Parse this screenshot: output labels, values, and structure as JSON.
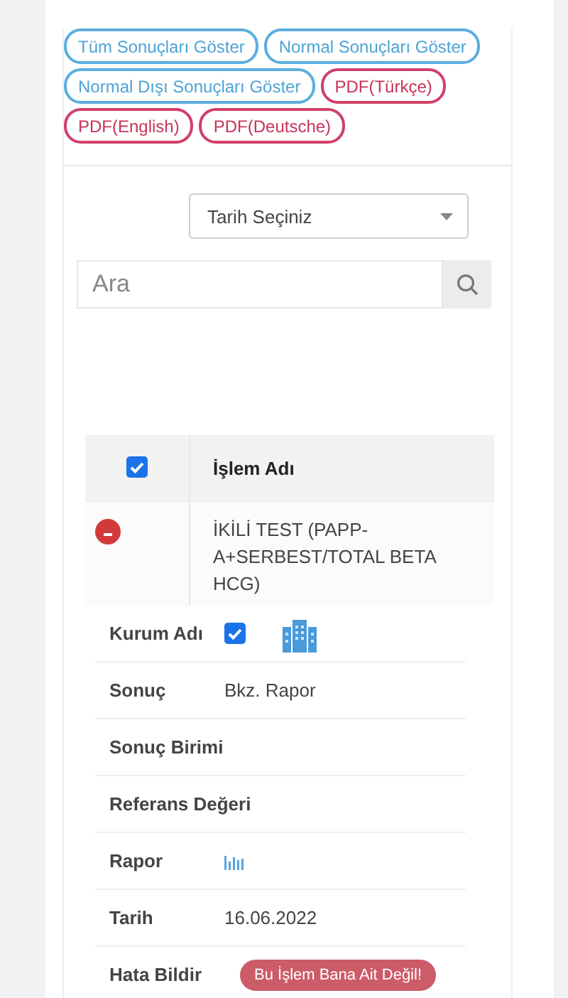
{
  "filters": [
    {
      "label": "Tüm Sonuçları Göster",
      "kind": "filter"
    },
    {
      "label": "Normal Sonuçları Göster",
      "kind": "filter"
    },
    {
      "label": "Normal Dışı Sonuçları Göster",
      "kind": "filter"
    },
    {
      "label": "PDF(Türkçe)",
      "kind": "pdf"
    },
    {
      "label": "PDF(English)",
      "kind": "pdf"
    },
    {
      "label": "PDF(Deutsche)",
      "kind": "pdf"
    }
  ],
  "date_select": {
    "value": "Tarih Seçiniz"
  },
  "search": {
    "placeholder": "Ara"
  },
  "table": {
    "header": {
      "checked": true,
      "column": "İşlem Adı"
    },
    "row": {
      "expanded": true,
      "name": "İKİLİ TEST (PAPP-A+SERBEST/TOTAL BETA HCG)"
    },
    "details": [
      {
        "kind": "institution",
        "label": "Kurum Adı",
        "checked": true
      },
      {
        "kind": "text",
        "label": "Sonuç",
        "value": "Bkz. Rapor"
      },
      {
        "kind": "text",
        "label": "Sonuç Birimi"
      },
      {
        "kind": "text",
        "label": "Referans Değeri"
      },
      {
        "kind": "report",
        "label": "Rapor"
      },
      {
        "kind": "text",
        "label": "Tarih",
        "value": "16.06.2022"
      },
      {
        "kind": "button",
        "label": "Hata Bildir",
        "value": "Bu İşlem Bana Ait Değil!"
      }
    ]
  }
}
